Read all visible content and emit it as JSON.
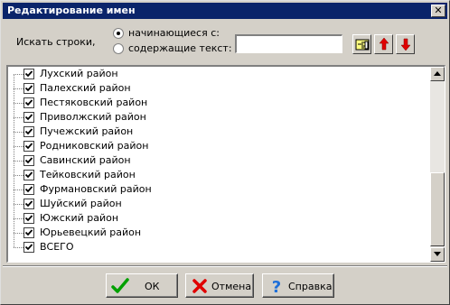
{
  "window": {
    "title": "Редактирование имен",
    "close_glyph": "✕"
  },
  "search": {
    "label": "Искать строки,",
    "options": [
      {
        "label": "начинающиеся с:",
        "checked": true
      },
      {
        "label": "содержащие текст:",
        "checked": false
      }
    ],
    "input_value": "",
    "find_icon": "hand-pointer-icon",
    "up_icon": "arrow-up-icon",
    "down_icon": "arrow-down-icon",
    "arrow_color": "#e00000"
  },
  "list": {
    "items": [
      {
        "label": "Лухский район",
        "checked": true
      },
      {
        "label": "Палехский район",
        "checked": true
      },
      {
        "label": "Пестяковский район",
        "checked": true
      },
      {
        "label": "Приволжский район",
        "checked": true
      },
      {
        "label": "Пучежский район",
        "checked": true
      },
      {
        "label": "Родниковский район",
        "checked": true
      },
      {
        "label": "Савинский район",
        "checked": true
      },
      {
        "label": "Тейковский район",
        "checked": true
      },
      {
        "label": "Фурмановский район",
        "checked": true
      },
      {
        "label": "Шуйский район",
        "checked": true
      },
      {
        "label": "Южский район",
        "checked": true
      },
      {
        "label": "Юрьевецкий район",
        "checked": true
      },
      {
        "label": "ВСЕГО",
        "checked": true
      }
    ]
  },
  "buttons": {
    "ok": {
      "label": "ОК",
      "icon": "checkmark-icon",
      "color": "#00a000"
    },
    "cancel": {
      "label": "Отмена",
      "icon": "x-mark-icon",
      "color": "#e00000"
    },
    "help": {
      "label": "Справка",
      "icon": "question-mark-icon",
      "color": "#1e6fd9"
    }
  }
}
